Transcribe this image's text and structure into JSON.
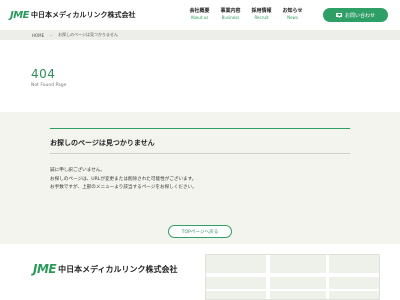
{
  "header": {
    "logo_mark": "JME",
    "logo_text": "中日本メディカルリンク株式会社",
    "nav": [
      {
        "label": "会社概要",
        "sub": "About us"
      },
      {
        "label": "事業内容",
        "sub": "Business"
      },
      {
        "label": "採用情報",
        "sub": "Recruit"
      },
      {
        "label": "お知らせ",
        "sub": "News"
      }
    ],
    "contact_label": "お問い合わせ"
  },
  "breadcrumb": {
    "home": "HOME",
    "separator": "—",
    "current": "お探しのページは見つかりません"
  },
  "hero": {
    "title": "404",
    "subtitle": "Not Found Page"
  },
  "content": {
    "heading": "お探しのページは見つかりません",
    "lines": [
      "誠に申し訳ございません。",
      "お探しのページは、URLが変更または削除された可能性がございます。",
      "お手数ですが、上部のメニューより該当するページをお探しください。"
    ],
    "top_button": "TOPページへ戻る"
  },
  "footer": {
    "logo_mark": "JME",
    "logo_text": "中日本メディカルリンク株式会社"
  },
  "colors": {
    "brand_green": "#2f9f68",
    "page_bg": "#f4f4ef"
  }
}
